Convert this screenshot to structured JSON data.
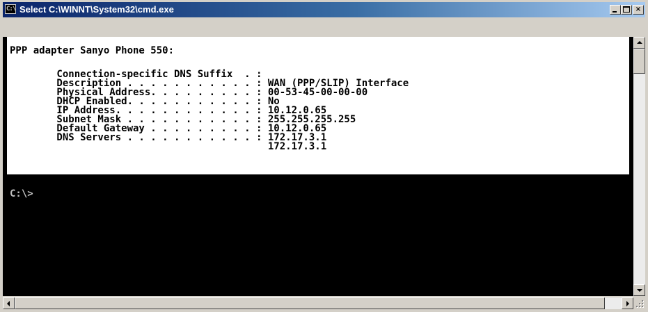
{
  "window": {
    "title": "Select C:\\WINNT\\System32\\cmd.exe",
    "icon": "cmd-icon",
    "icon_text": "C:\\",
    "controls": {
      "minimize": "minimize-icon",
      "maximize": "maximize-icon",
      "close": "close-icon",
      "close_glyph": "×"
    }
  },
  "console": {
    "selected_lines": [
      "PPP adapter Sanyo Phone 550:",
      "",
      "        Connection-specific DNS Suffix  . :",
      "        Description . . . . . . . . . . . : WAN (PPP/SLIP) Interface",
      "        Physical Address. . . . . . . . . : 00-53-45-00-00-00",
      "        DHCP Enabled. . . . . . . . . . . : No",
      "        IP Address. . . . . . . . . . . . : 10.12.0.65",
      "        Subnet Mask . . . . . . . . . . . : 255.255.255.255",
      "        Default Gateway . . . . . . . . . : 10.12.0.65",
      "        DNS Servers . . . . . . . . . . . : 172.17.3.1",
      "                                            172.17.3.1"
    ],
    "prompt": "C:\\>",
    "colors": {
      "background": "#000000",
      "foreground": "#c0c0c0",
      "selection_bg": "#ffffff",
      "selection_fg": "#000000"
    }
  },
  "scrollbars": {
    "vertical": {
      "up": "arrow-up-icon",
      "down": "arrow-down-icon",
      "position": 0.0
    },
    "horizontal": {
      "left": "arrow-left-icon",
      "right": "arrow-right-icon",
      "position": 0.0
    }
  },
  "colors": {
    "titlebar_start": "#0a246a",
    "titlebar_end": "#a6caf0",
    "chrome": "#d4d0c8"
  }
}
